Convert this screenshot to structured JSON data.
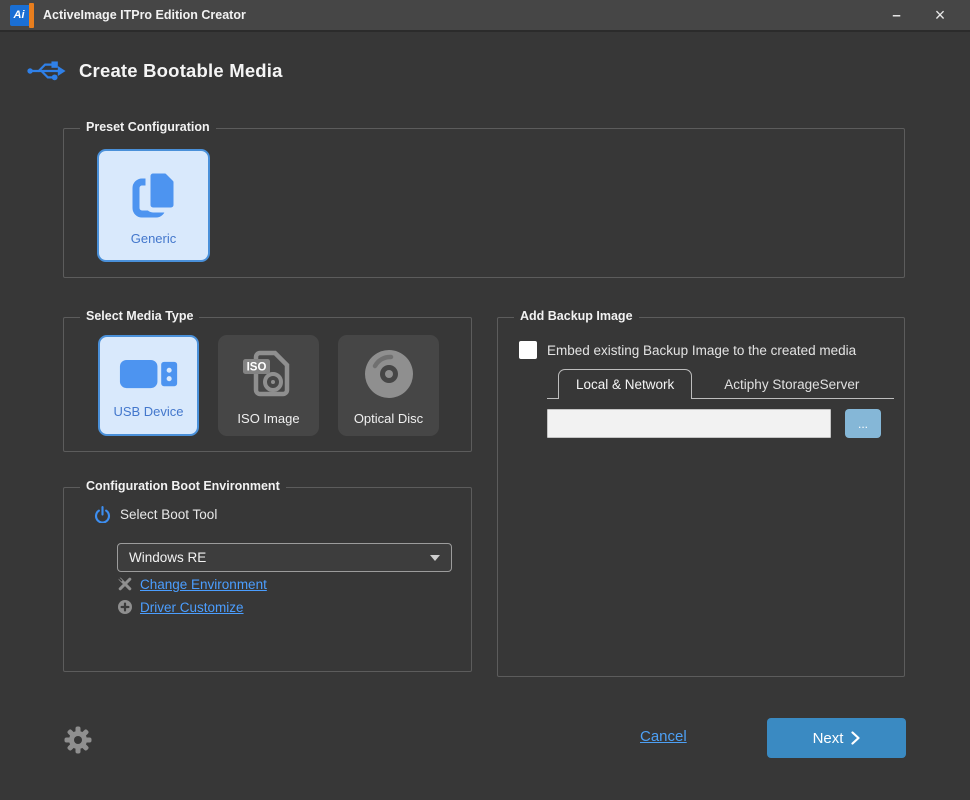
{
  "window": {
    "title": "ActiveImage ITPro Edition Creator",
    "app_icon_text": "Ai",
    "controls": {
      "minimize": "–",
      "close": "×"
    }
  },
  "header": {
    "title": "Create Bootable Media"
  },
  "preset": {
    "group_label": "Preset Configuration",
    "tiles": [
      {
        "label": "Generic",
        "selected": true
      }
    ]
  },
  "media": {
    "group_label": "Select Media Type",
    "tiles": [
      {
        "label": "USB Device",
        "selected": true
      },
      {
        "label": "ISO Image",
        "selected": false,
        "badge": "ISO"
      },
      {
        "label": "Optical Disc",
        "selected": false
      }
    ]
  },
  "backup": {
    "group_label": "Add Backup Image",
    "checkbox_label": "Embed existing Backup Image to the created media",
    "checkbox_checked": false,
    "tabs": [
      {
        "label": "Local & Network",
        "active": true
      },
      {
        "label": "Actiphy StorageServer",
        "active": false
      }
    ],
    "path_value": "",
    "browse_label": "..."
  },
  "boot_env": {
    "group_label": "Configuration Boot Environment",
    "select_label": "Select Boot Tool",
    "dropdown_value": "Windows RE",
    "links": [
      {
        "label": "Change Environment"
      },
      {
        "label": "Driver Customize"
      }
    ]
  },
  "footer": {
    "cancel_label": "Cancel",
    "next_label": "Next"
  },
  "icons": {
    "titlebar": "app-logo, minimize, close",
    "header": "usb-trident",
    "tiles": "copy-document, usb-drive, iso-file, optical-disc",
    "boot": "power, tools, plus-circle",
    "footer": "gear, chevron-right"
  },
  "colors": {
    "background": "#373737",
    "titlebar": "#464646",
    "group_border": "#5c5c5c",
    "tile_dark": "#464646",
    "tile_selected_bg": "#d9e9fc",
    "tile_selected_border": "#4a90d9",
    "accent_blue": "#4d94f0",
    "link_blue": "#4b9eff",
    "next_button": "#3a8ac2",
    "browse_button": "#85b7d7",
    "gray_icon": "#8f8f8f"
  }
}
